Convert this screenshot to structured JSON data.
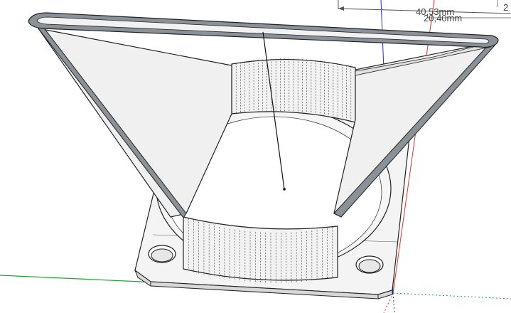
{
  "app": {
    "name": "3D modeling viewport"
  },
  "viewport": {
    "background": "#ffffff",
    "model": "fan duct with square mounting flange",
    "model_color": "#f4f4f4",
    "edge_color": "#222222",
    "rim_band_color": "#8a9298",
    "axes": {
      "red": "#e0342c",
      "green": "#1faa2a",
      "blue": "#2433c8"
    }
  },
  "dimensions": [
    {
      "label": "40,53mm"
    },
    {
      "label": "20,40mm"
    },
    {
      "label": "2"
    }
  ]
}
